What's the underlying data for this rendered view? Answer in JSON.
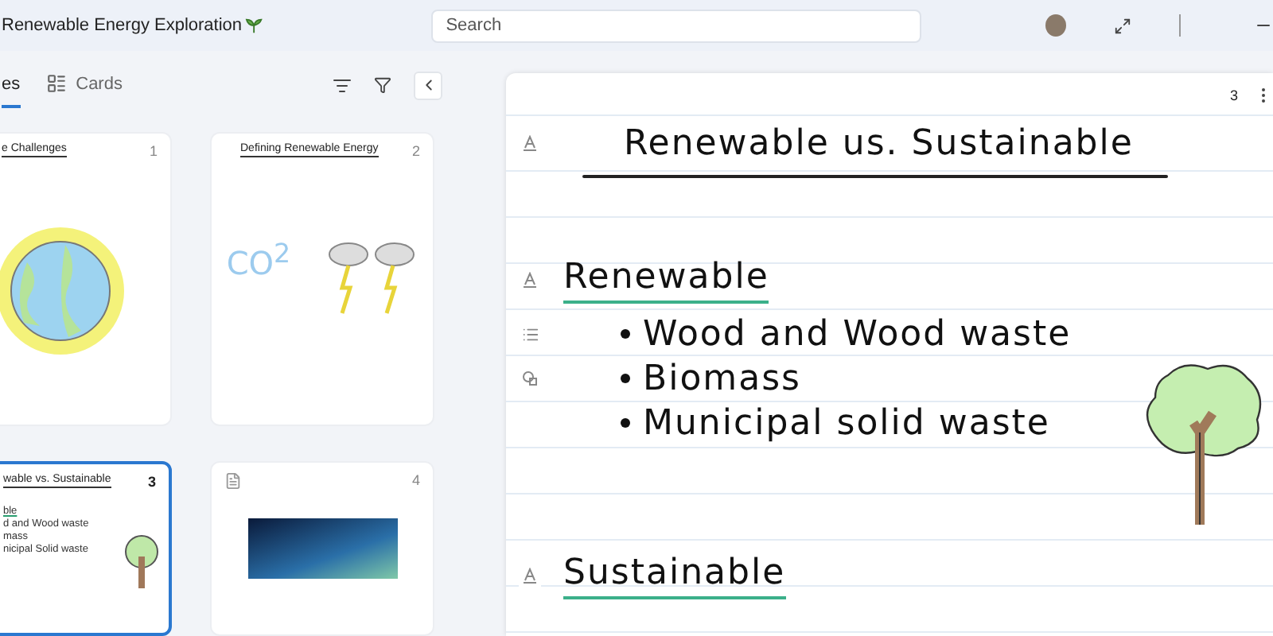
{
  "app": {
    "title": "Renewable Energy Exploration",
    "search": {
      "placeholder": "Search"
    }
  },
  "sidebar": {
    "tabs": [
      {
        "label": "es",
        "selected": true
      },
      {
        "label": "Cards",
        "selected": false
      }
    ],
    "cards": [
      {
        "kind": "earth",
        "title": "e Challenges",
        "number": "1",
        "selected": false
      },
      {
        "kind": "co2",
        "title": "Defining Renewable Energy",
        "number": "2",
        "selected": false,
        "art_label": "CO$^{2}$"
      },
      {
        "kind": "tree",
        "title": "wable vs. Sustainable",
        "number": "3",
        "selected": true,
        "lines": [
          "ble",
          "d and Wood waste",
          "mass",
          "nicipal Solid waste"
        ]
      },
      {
        "kind": "pdf",
        "number": "4",
        "selected": false
      }
    ]
  },
  "page": {
    "number": "3",
    "title": "Renewable us. Sustainable",
    "sections": [
      {
        "heading": "Renewable",
        "items": [
          "Wood and Wood waste",
          "Biomass",
          "Municipal solid waste"
        ]
      },
      {
        "heading": "Sustainable"
      }
    ]
  }
}
